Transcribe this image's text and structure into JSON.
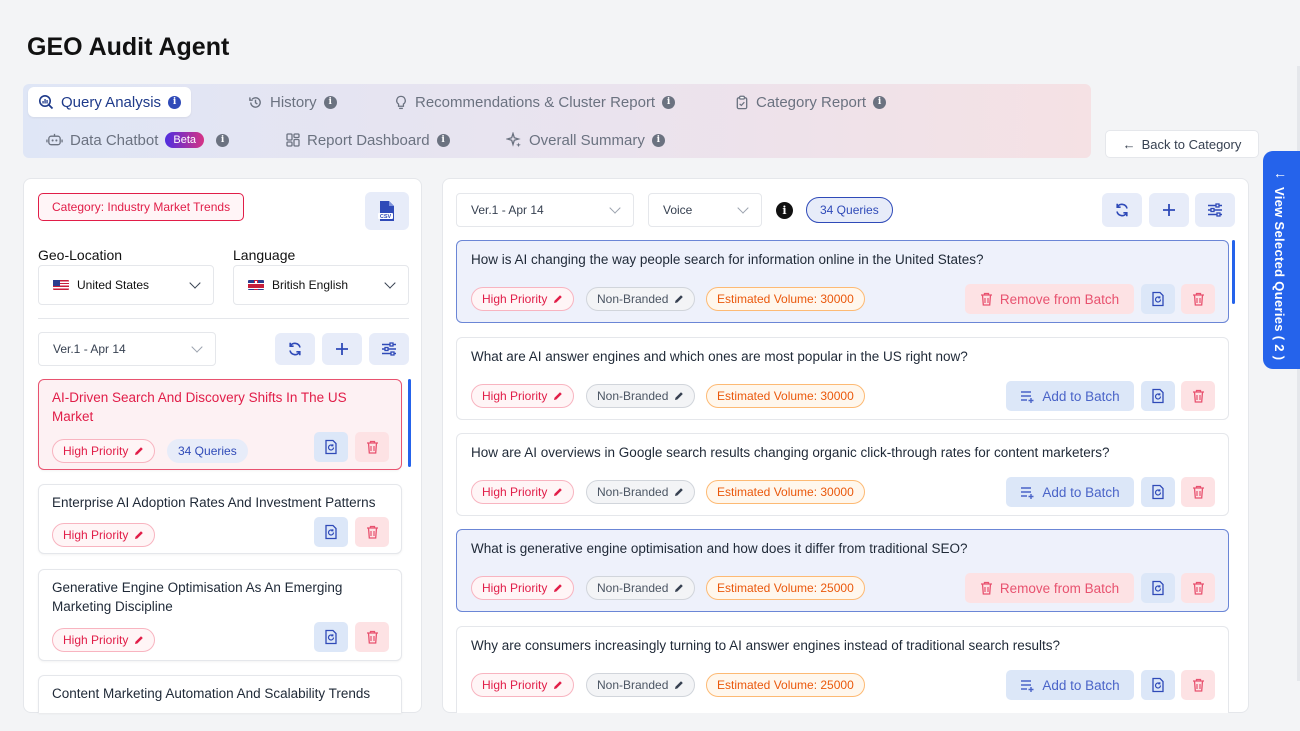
{
  "app": {
    "title": "GEO Audit Agent"
  },
  "tabs": [
    {
      "label": "Query Analysis",
      "icon": "search-chart-icon",
      "active": true
    },
    {
      "label": "History",
      "icon": "history-icon"
    },
    {
      "label": "Recommendations & Cluster Report",
      "icon": "lightbulb-icon"
    },
    {
      "label": "Category Report",
      "icon": "clipboard-icon"
    },
    {
      "label": "Data Chatbot",
      "icon": "bot-icon",
      "badge": "Beta"
    },
    {
      "label": "Report Dashboard",
      "icon": "dashboard-icon"
    },
    {
      "label": "Overall Summary",
      "icon": "sparkle-icon"
    }
  ],
  "back_button": {
    "label": "Back to Category"
  },
  "side_tab": {
    "label": "View Selected Queries ( 2 )"
  },
  "left": {
    "category_badge": "Category: Industry Market Trends",
    "csv_icon_label": "CSV",
    "geo_label": "Geo-Location",
    "geo_value": "United States",
    "lang_label": "Language",
    "lang_value": "British English",
    "version": "Ver.1 - Apr 14",
    "clusters": [
      {
        "title": "AI-Driven Search And Discovery Shifts In The US Market",
        "priority": "High Priority",
        "queries": "34 Queries",
        "selected": true
      },
      {
        "title": "Enterprise AI Adoption Rates And Investment Patterns",
        "priority": "High Priority"
      },
      {
        "title": "Generative Engine Optimisation As An Emerging Marketing Discipline",
        "priority": "High Priority"
      },
      {
        "title": "Content Marketing Automation And Scalability Trends"
      }
    ]
  },
  "right": {
    "version": "Ver.1 - Apr 14",
    "type": "Voice",
    "query_count": "34 Queries",
    "queries": [
      {
        "text": "How is AI changing the way people search for information online in the United States?",
        "priority": "High Priority",
        "branding": "Non-Branded",
        "volume": "Estimated Volume: 30000",
        "action": "Remove from Batch",
        "selected": true
      },
      {
        "text": "What are AI answer engines and which ones are most popular in the US right now?",
        "priority": "High Priority",
        "branding": "Non-Branded",
        "volume": "Estimated Volume: 30000",
        "action": "Add to Batch"
      },
      {
        "text": "How are AI overviews in Google search results changing organic click-through rates for content marketers?",
        "priority": "High Priority",
        "branding": "Non-Branded",
        "volume": "Estimated Volume: 30000",
        "action": "Add to Batch"
      },
      {
        "text": "What is generative engine optimisation and how does it differ from traditional SEO?",
        "priority": "High Priority",
        "branding": "Non-Branded",
        "volume": "Estimated Volume: 25000",
        "action": "Remove from Batch",
        "selected": true
      },
      {
        "text": "Why are consumers increasingly turning to AI answer engines instead of traditional search results?",
        "priority": "High Priority",
        "branding": "Non-Branded",
        "volume": "Estimated Volume: 25000",
        "action": "Add to Batch"
      }
    ]
  },
  "colors": {
    "accent": "#2563eb",
    "danger": "#e11d48",
    "volume": "#ea580c"
  }
}
